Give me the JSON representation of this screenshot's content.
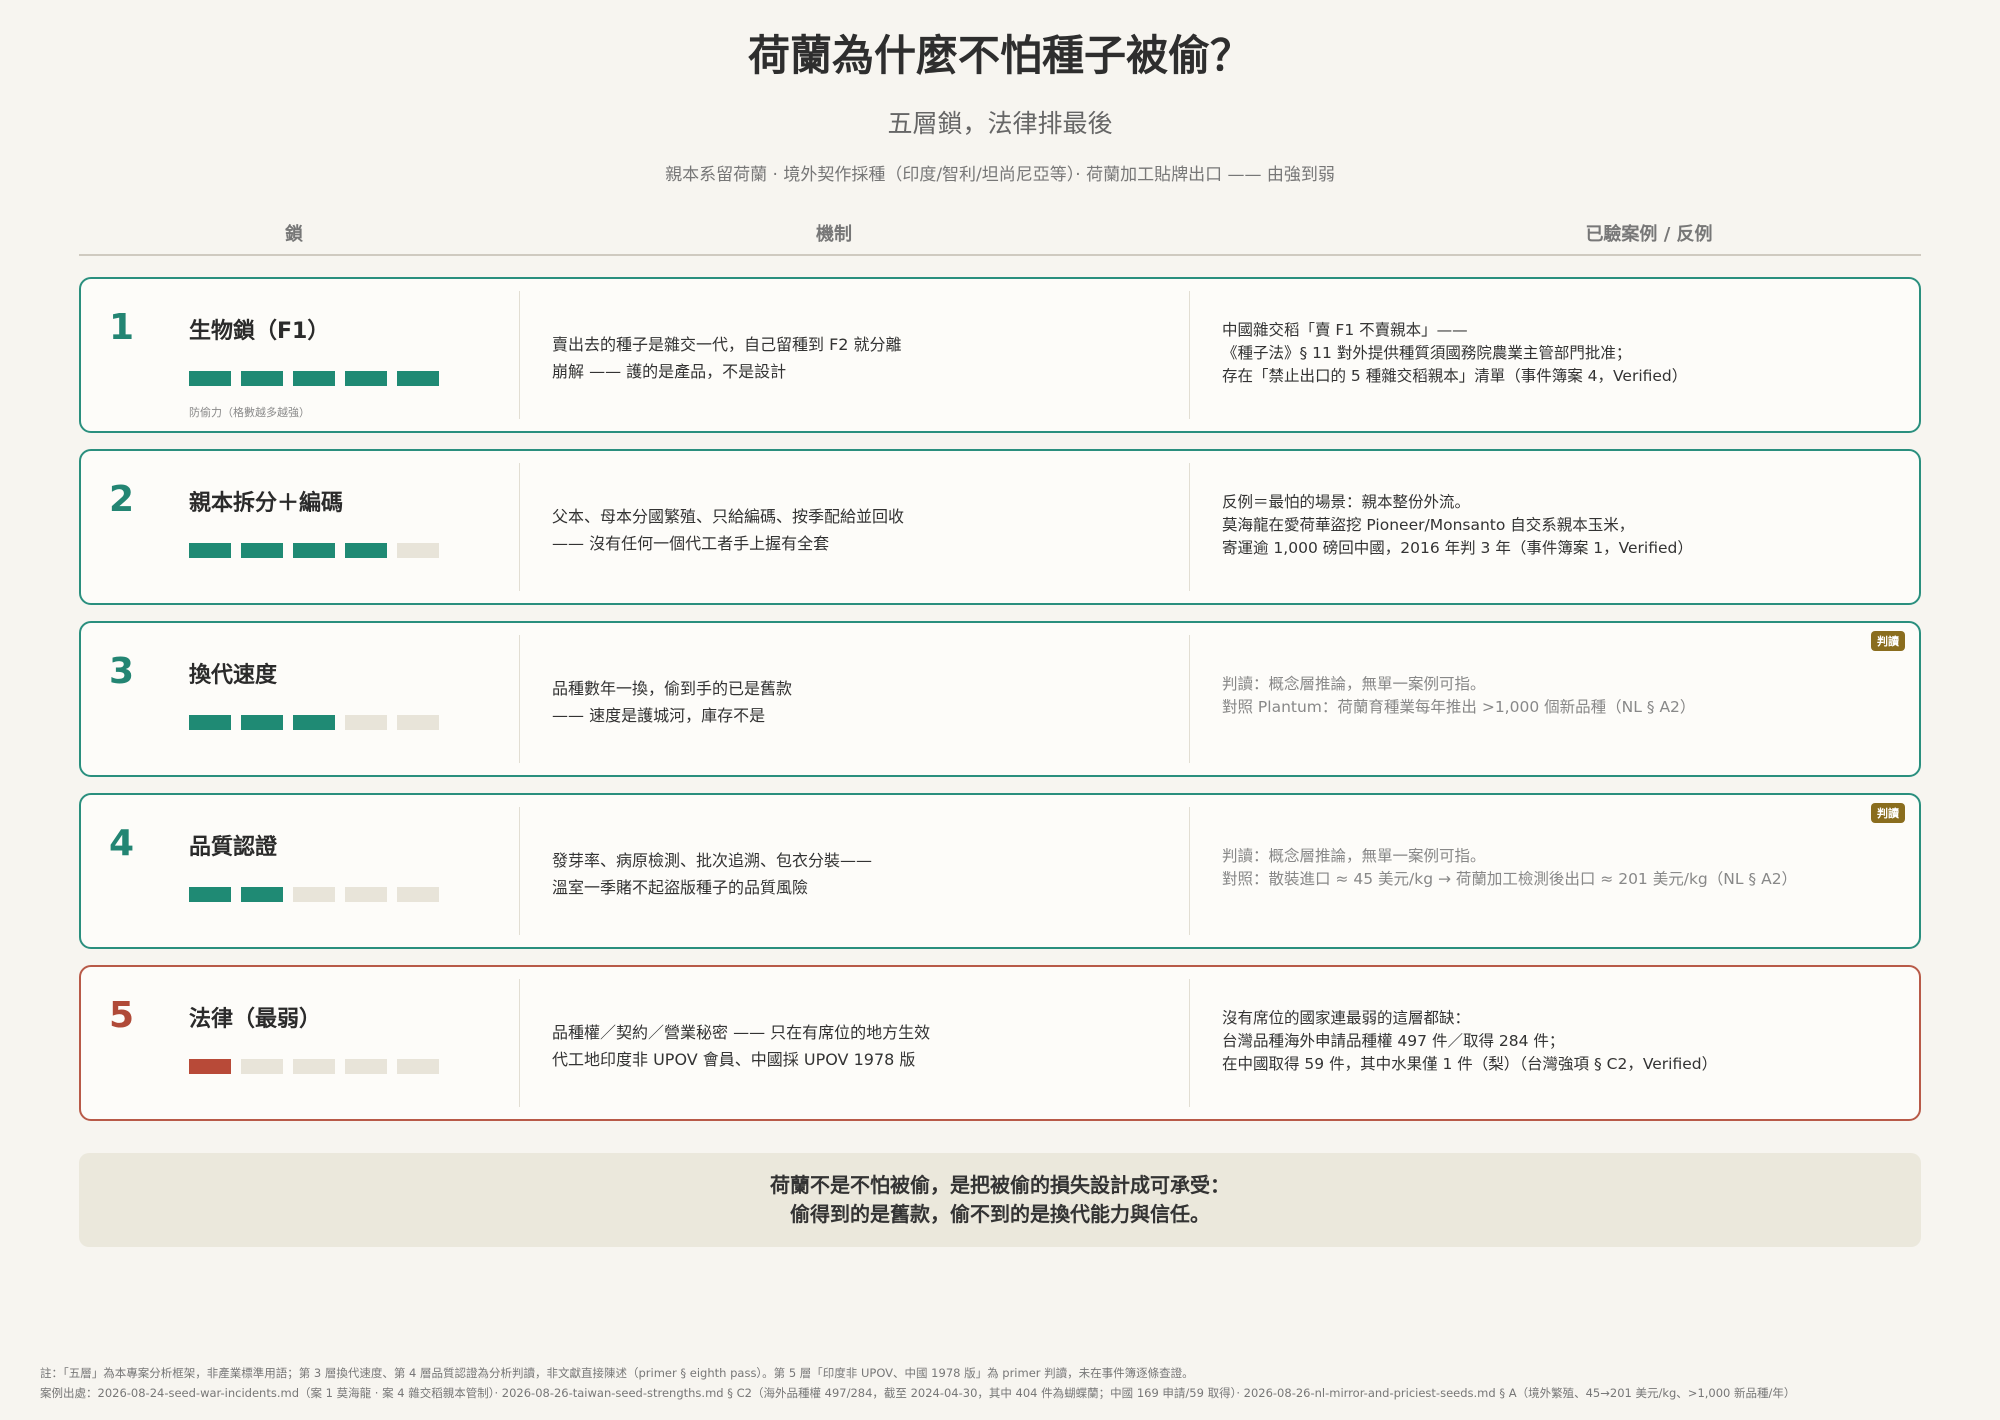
{
  "title": "荷蘭為什麼不怕種子被偷？",
  "subtitle": "五層鎖，法律排最後",
  "tagline": "親本系留荷蘭 · 境外契作採種（印度/智利/坦尚尼亞等）· 荷蘭加工貼牌出口 —— 由強到弱",
  "columns": {
    "lock": "鎖",
    "mechanism": "機制",
    "cases": "已驗案例 / 反例"
  },
  "colors": {
    "teal": "#1f8a74",
    "red": "#b84a38",
    "empty": "#e8e4d9",
    "badge": "#8a6d1e"
  },
  "bar_note": "防偷力（格數越多越強）",
  "locks": [
    {
      "num": "1",
      "name": "生物鎖（F1）",
      "strength": 5,
      "mech": [
        "賣出去的種子是雜交一代，自己留種到 F2 就分離",
        "崩解 —— 護的是產品，不是設計"
      ],
      "cases": [
        "中國雜交稻「賣 F1 不賣親本」——",
        "《種子法》§ 11 對外提供種質須國務院農業主管部門批准；",
        "存在「禁止出口的 5 種雜交稻親本」清單（事件簿案 4，Verified）"
      ],
      "muted": false,
      "badge": ""
    },
    {
      "num": "2",
      "name": "親本拆分＋編碼",
      "strength": 4,
      "mech": [
        "父本、母本分國繁殖、只給編碼、按季配給並回收",
        "—— 沒有任何一個代工者手上握有全套"
      ],
      "cases": [
        "反例＝最怕的場景：親本整份外流。",
        "莫海龍在愛荷華盜挖 Pioneer/Monsanto 自交系親本玉米，",
        "寄運逾 1,000 磅回中國，2016 年判 3 年（事件簿案 1，Verified）"
      ],
      "muted": false,
      "badge": ""
    },
    {
      "num": "3",
      "name": "換代速度",
      "strength": 3,
      "mech": [
        "品種數年一換，偷到手的已是舊款",
        "—— 速度是護城河，庫存不是"
      ],
      "cases": [
        "判讀：概念層推論，無單一案例可指。",
        "對照 Plantum：荷蘭育種業每年推出 >1,000 個新品種（NL § A2）"
      ],
      "muted": true,
      "badge": "判讀"
    },
    {
      "num": "4",
      "name": "品質認證",
      "strength": 2,
      "mech": [
        "發芽率、病原檢測、批次追溯、包衣分裝——",
        "溫室一季賭不起盜版種子的品質風險"
      ],
      "cases": [
        "判讀：概念層推論，無單一案例可指。",
        "對照：散裝進口 ≈ 45 美元/kg → 荷蘭加工檢測後出口 ≈ 201 美元/kg（NL § A2）"
      ],
      "muted": true,
      "badge": "判讀"
    },
    {
      "num": "5",
      "name": "法律（最弱）",
      "strength": 1,
      "mech": [
        "品種權／契約／營業秘密 —— 只在有席位的地方生效",
        "代工地印度非 UPOV 會員、中國採 UPOV 1978 版"
      ],
      "cases": [
        "沒有席位的國家連最弱的這層都缺：",
        "台灣品種海外申請品種權 497 件／取得 284 件；",
        "在中國取得 59 件，其中水果僅 1 件（梨）（台灣強項 § C2，Verified）"
      ],
      "muted": false,
      "badge": ""
    }
  ],
  "conclusion": [
    "荷蘭不是不怕被偷，是把被偷的損失設計成可承受：",
    "偷得到的是舊款，偷不到的是換代能力與信任。"
  ],
  "footnotes": [
    "註：「五層」為本專案分析框架，非產業標準用語；第 3 層換代速度、第 4 層品質認證為分析判讀，非文獻直接陳述（primer § eighth pass）。第 5 層「印度非 UPOV、中國 1978 版」為 primer 判讀，未在事件簿逐條查證。",
    "案例出處：2026-08-24-seed-war-incidents.md（案 1 莫海龍 · 案 4 雜交稻親本管制）· 2026-08-26-taiwan-seed-strengths.md § C2（海外品種權 497/284，截至 2024-04-30，其中 404 件為蝴蝶蘭；中國 169 申請/59 取得）· 2026-08-26-nl-mirror-and-priciest-seeds.md § A（境外繁殖、45→201 美元/kg、>1,000 新品種/年）"
  ]
}
